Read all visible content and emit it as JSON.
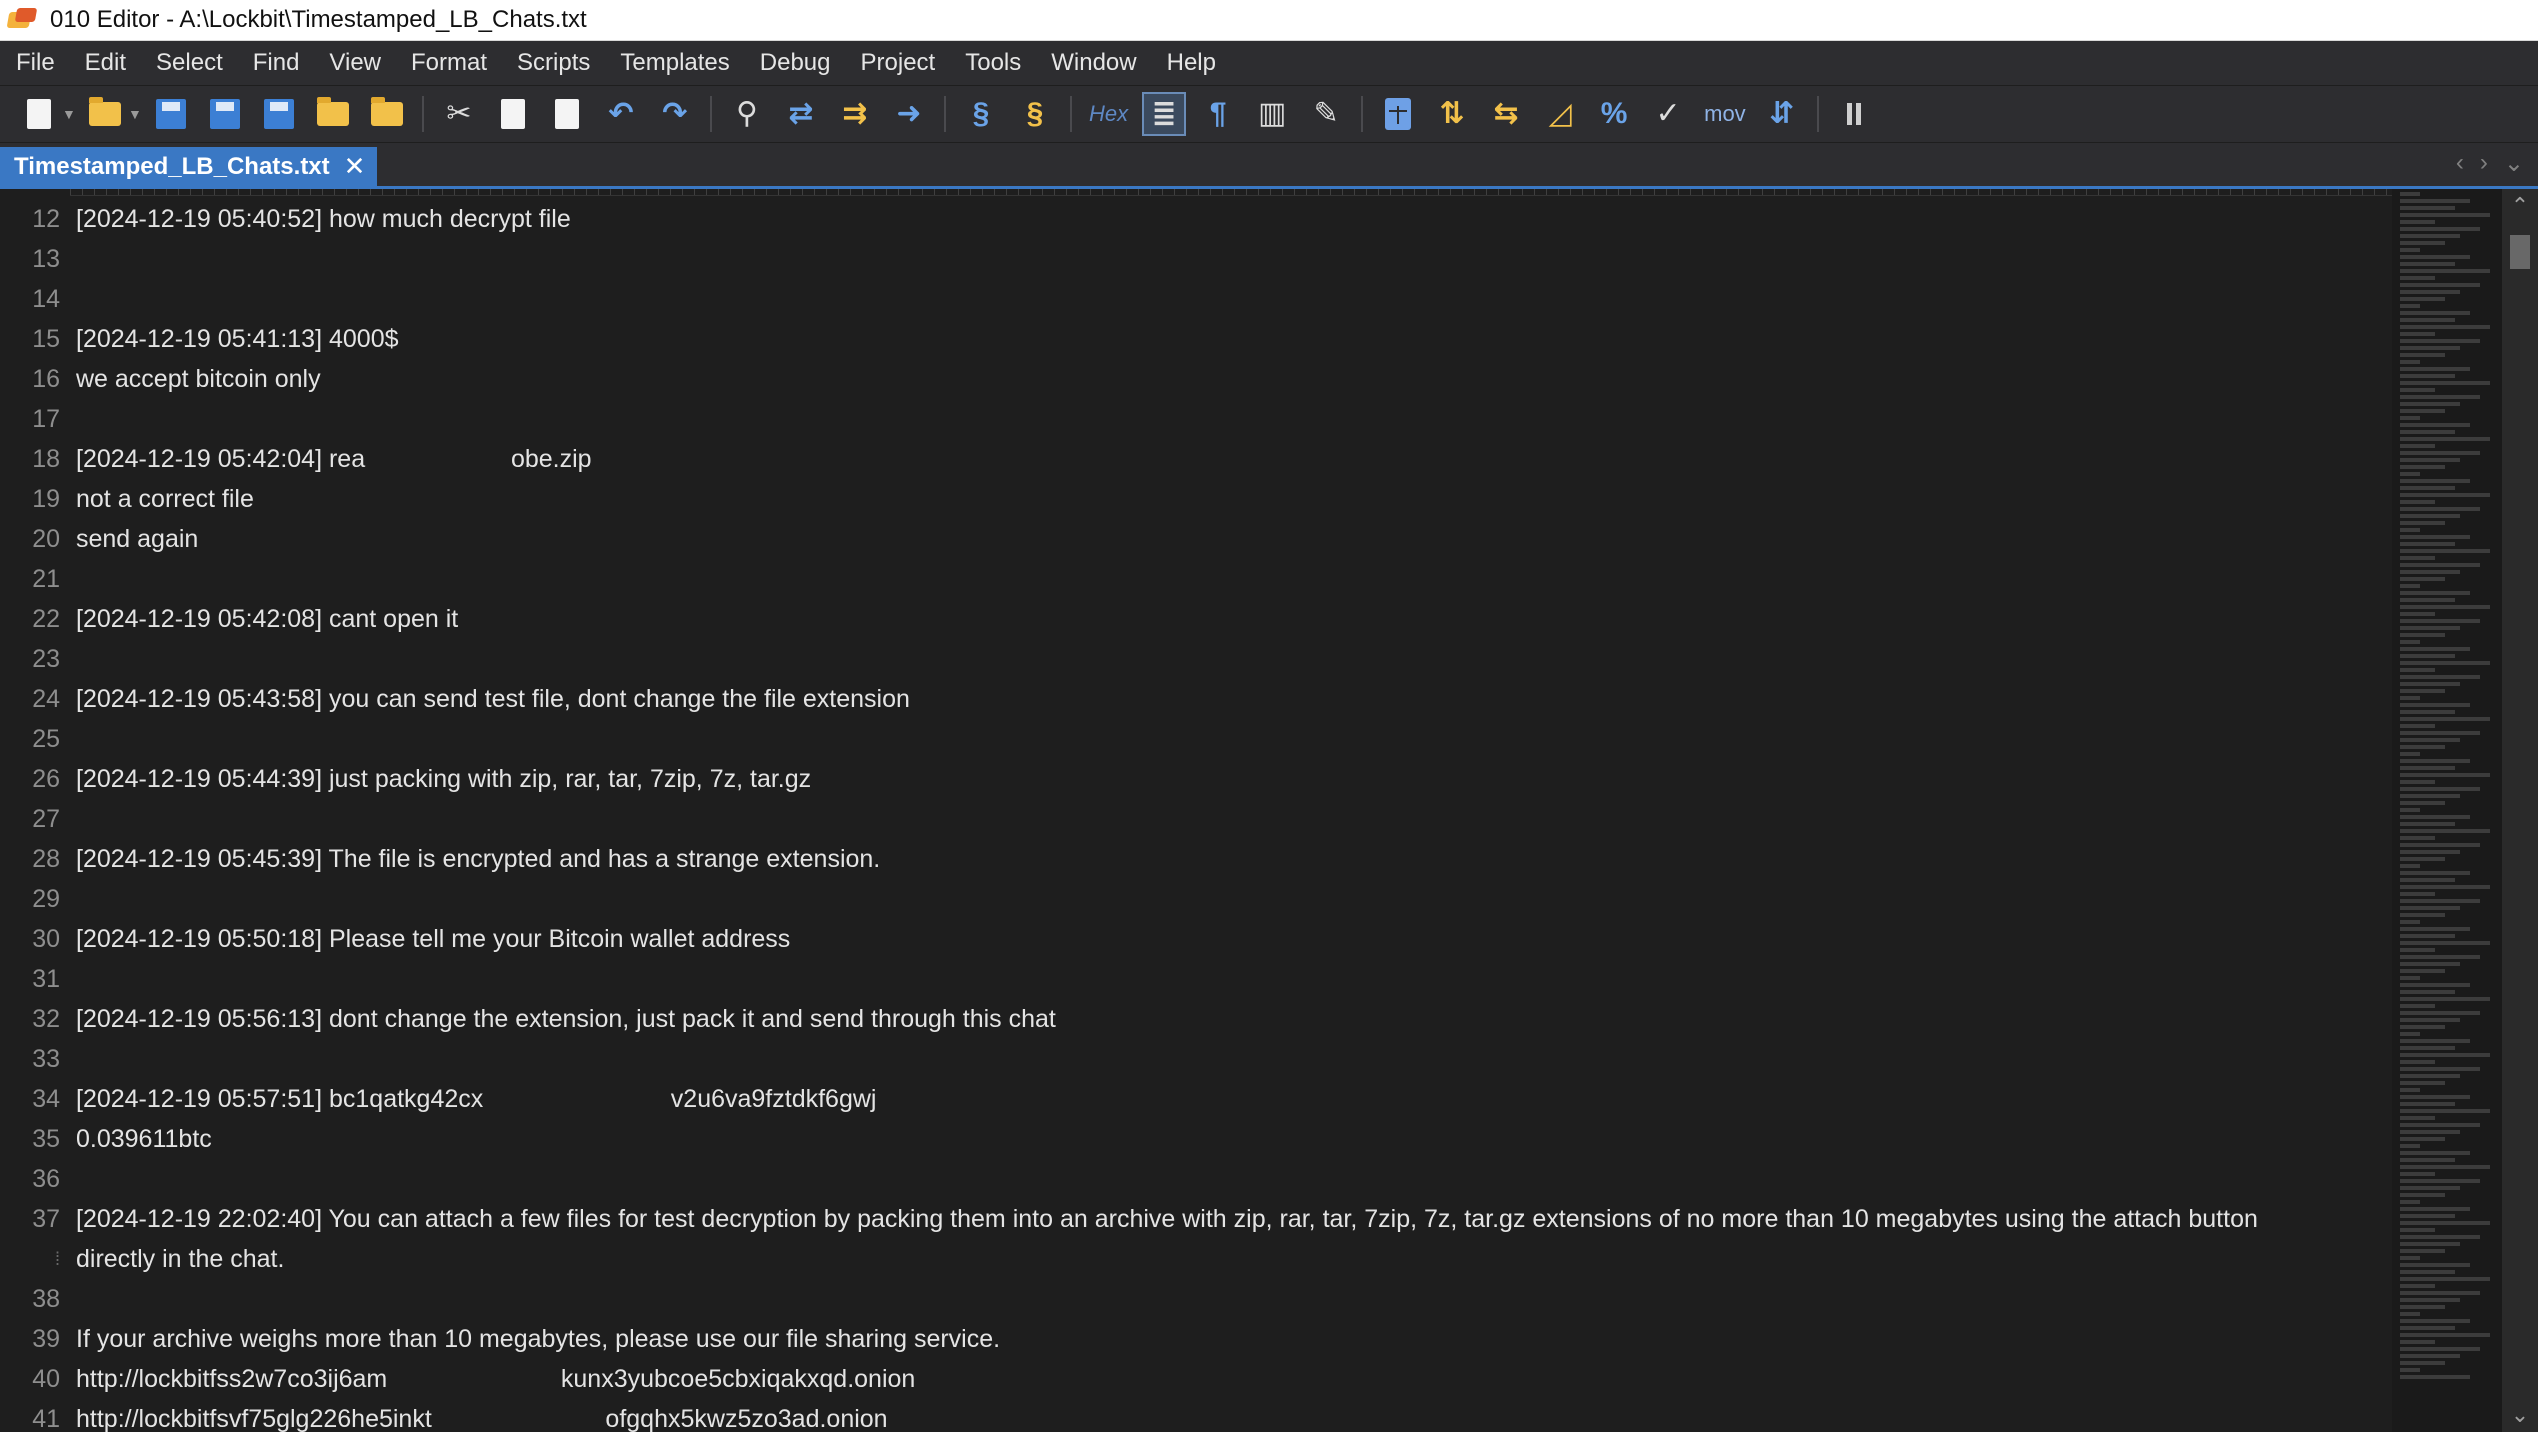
{
  "window": {
    "title": "010 Editor - A:\\Lockbit\\Timestamped_LB_Chats.txt"
  },
  "menu": [
    "File",
    "Edit",
    "Select",
    "Find",
    "View",
    "Format",
    "Scripts",
    "Templates",
    "Debug",
    "Project",
    "Tools",
    "Window",
    "Help"
  ],
  "toolbar": {
    "hex_label": "Hex",
    "mov_label": "mov"
  },
  "tab": {
    "label": "Timestamped_LB_Chats.txt",
    "close": "✕"
  },
  "editor": {
    "lines": [
      {
        "n": "12",
        "t": "[2024-12-19 05:40:52] how much decrypt file"
      },
      {
        "n": "13",
        "t": ""
      },
      {
        "n": "14",
        "t": ""
      },
      {
        "n": "15",
        "t": "[2024-12-19 05:41:13] 4000$"
      },
      {
        "n": "16",
        "t": "we accept bitcoin only"
      },
      {
        "n": "17",
        "t": ""
      },
      {
        "n": "18",
        "t": "[2024-12-19 05:42:04] rea                     obe.zip"
      },
      {
        "n": "19",
        "t": "not a correct file"
      },
      {
        "n": "20",
        "t": "send again"
      },
      {
        "n": "21",
        "t": ""
      },
      {
        "n": "22",
        "t": "[2024-12-19 05:42:08] cant open it"
      },
      {
        "n": "23",
        "t": ""
      },
      {
        "n": "24",
        "t": "[2024-12-19 05:43:58] you can send test file, dont change the file extension"
      },
      {
        "n": "25",
        "t": ""
      },
      {
        "n": "26",
        "t": "[2024-12-19 05:44:39] just packing with zip, rar, tar, 7zip, 7z, tar.gz"
      },
      {
        "n": "27",
        "t": ""
      },
      {
        "n": "28",
        "t": "[2024-12-19 05:45:39] The file is encrypted and has a strange extension."
      },
      {
        "n": "29",
        "t": ""
      },
      {
        "n": "30",
        "t": "[2024-12-19 05:50:18] Please tell me your Bitcoin wallet address"
      },
      {
        "n": "31",
        "t": ""
      },
      {
        "n": "32",
        "t": "[2024-12-19 05:56:13] dont change the extension, just pack it and send through this chat"
      },
      {
        "n": "33",
        "t": ""
      },
      {
        "n": "34",
        "t": "[2024-12-19 05:57:51] bc1qatkg42cx                           v2u6va9fztdkf6gwj"
      },
      {
        "n": "35",
        "t": "0.039611btc"
      },
      {
        "n": "36",
        "t": ""
      },
      {
        "n": "37",
        "t": "[2024-12-19 22:02:40] You can attach a few files for test decryption by packing them into an archive with zip, rar, tar, 7zip, 7z, tar.gz extensions of no more than 10 megabytes using the attach button"
      },
      {
        "n": "",
        "t": "directly in the chat.",
        "wrap": true
      },
      {
        "n": "38",
        "t": ""
      },
      {
        "n": "39",
        "t": "If your archive weighs more than 10 megabytes, please use our file sharing service."
      },
      {
        "n": "40",
        "t": "http://lockbitfss2w7co3ij6am                         kunx3yubcoe5cbxiqakxqd.onion"
      },
      {
        "n": "41",
        "t": "http://lockbitfsvf75glg226he5inkt                         ofgqhx5kwz5zo3ad.onion"
      }
    ]
  }
}
